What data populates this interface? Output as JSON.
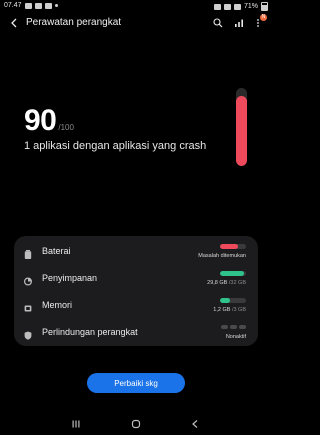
{
  "status_bar": {
    "time": "07.47",
    "battery_percent": "71%"
  },
  "app_bar": {
    "back_icon": "back-arrow-icon",
    "title": "Perawatan perangkat",
    "search_icon": "search-icon",
    "stats_icon": "signal-stats-icon",
    "more_icon": "more-vertical-icon",
    "notification_badge": "N"
  },
  "summary": {
    "score": "90",
    "score_max": "/100",
    "message": "1 aplikasi dengan aplikasi yang crash",
    "gauge_level_percent": 90,
    "gauge_color": "#ee4a5c"
  },
  "items": [
    {
      "icon": "battery-icon",
      "label": "Baterai",
      "status": "Masalah ditemukan",
      "bar_fill_fraction": 0.7,
      "bar_color": "#ee4a5c"
    },
    {
      "icon": "storage-icon",
      "label": "Penyimpanan",
      "value": "29,8 GB",
      "total": "/32 GB",
      "bar_fill_fraction": 0.93,
      "bar_color": "#2fc28b"
    },
    {
      "icon": "memory-icon",
      "label": "Memori",
      "value": "1,2 GB",
      "total": "/3 GB",
      "bar_fill_fraction": 0.4,
      "bar_color": "#2fc28b"
    },
    {
      "icon": "shield-icon",
      "label": "Perlindungan perangkat",
      "status": "Nonaktif"
    }
  ],
  "action_button": {
    "label": "Perbaiki skg",
    "color": "#1a73e8"
  },
  "nav_bar": {
    "recent_icon": "recent-apps-icon",
    "home_icon": "home-icon",
    "back_icon": "nav-back-icon"
  }
}
